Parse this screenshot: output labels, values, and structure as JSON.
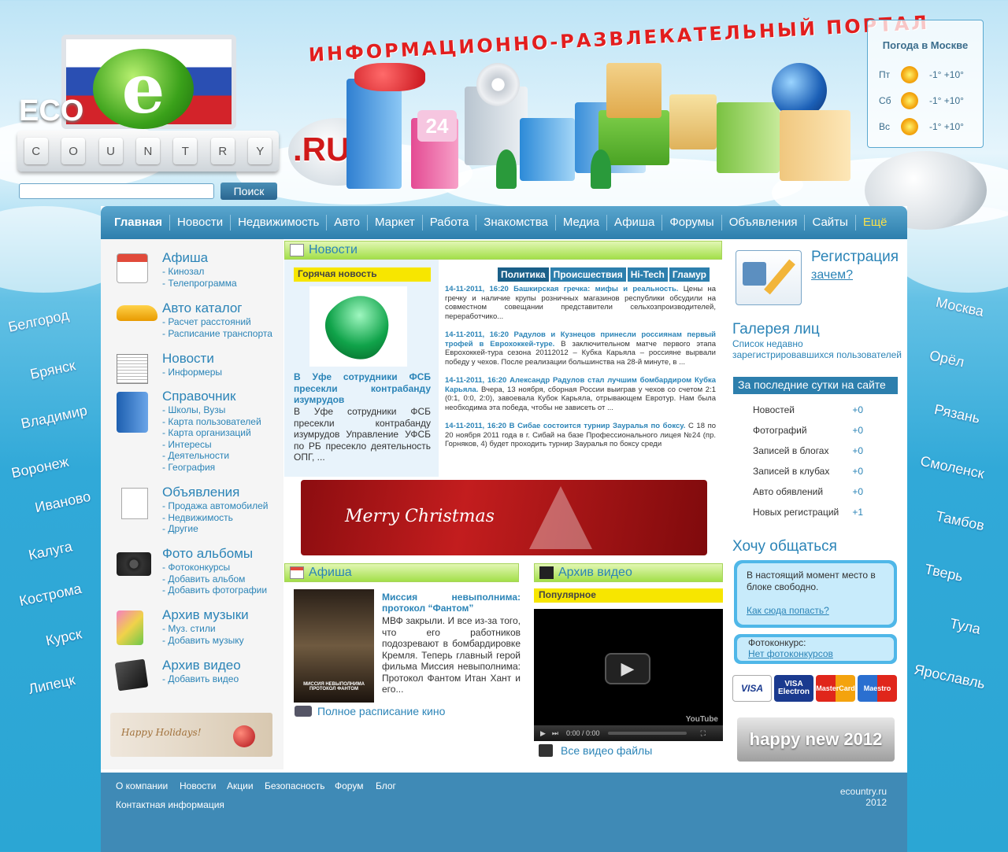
{
  "header": {
    "logo_eco": "ECO",
    "logo_letter": "e",
    "logo_keys": [
      "C",
      "O",
      "U",
      "N",
      "T",
      "R",
      "Y"
    ],
    "domain_badge": ".RU",
    "tagline": "ИНФОРМАЦИОННО-РАЗВЛЕКАТЕЛЬНЫЙ ПОРТАЛ",
    "search_placeholder": "",
    "search_button": "Поиск"
  },
  "weather": {
    "title": "Погода в Москве",
    "days": [
      {
        "day": "Пт",
        "icon": "sun-icon",
        "temp": "-1° +10°"
      },
      {
        "day": "Сб",
        "icon": "sun-icon",
        "temp": "-1° +10°"
      },
      {
        "day": "Вс",
        "icon": "sun-icon",
        "temp": "-1° +10°"
      }
    ]
  },
  "cities_left": [
    "Белгород",
    "Брянск",
    "Владимир",
    "Воронеж",
    "Иваново",
    "Калуга",
    "Кострома",
    "Курск",
    "Липецк"
  ],
  "cities_right": [
    "Москва",
    "Орёл",
    "Рязань",
    "Смоленск",
    "Тамбов",
    "Тверь",
    "Тула",
    "Ярославль"
  ],
  "nav": [
    "Главная",
    "Новости",
    "Недвижимость",
    "Авто",
    "Маркет",
    "Работа",
    "Знакомства",
    "Медиа",
    "Афиша",
    "Форумы",
    "Объявления",
    "Сайты",
    "Ещё"
  ],
  "sidebar": [
    {
      "title": "Афиша",
      "links": [
        "- Кинозал",
        "- Телепрограмма"
      ],
      "icon": "calendar-icon"
    },
    {
      "title": "Авто каталог",
      "links": [
        "- Расчет расстояний",
        "- Расписание транспорта"
      ],
      "icon": "car-icon"
    },
    {
      "title": "Новости",
      "links": [
        "- Информеры"
      ],
      "icon": "newspaper-icon"
    },
    {
      "title": "Справочник",
      "links": [
        "- Школы, Вузы",
        "- Карта пользователей",
        "- Карта организаций",
        "- Интересы",
        "- Деятельности",
        "- География"
      ],
      "icon": "address-book-icon"
    },
    {
      "title": "Объявления",
      "links": [
        "- Продажа автомобилей",
        "- Недвижимость",
        "- Другие"
      ],
      "icon": "pencil-icon"
    },
    {
      "title": "Фото альбомы",
      "links": [
        "- Фотоконкурсы",
        "- Добавить альбом",
        "- Добавить фотографии"
      ],
      "icon": "camera-icon"
    },
    {
      "title": "Архив музыки",
      "links": [
        "- Муз. стили",
        "- Добавить музыку"
      ],
      "icon": "music-icon"
    },
    {
      "title": "Архив видео",
      "links": [
        "- Добавить видео"
      ],
      "icon": "video-icon"
    }
  ],
  "holidays_banner": "Happy Holidays!",
  "news": {
    "header": "Новости",
    "hot_label": "Горячая новость",
    "hot_title": "В Уфе сотрудники ФСБ пресекли контрабанду изумрудов",
    "hot_text": "В Уфе сотрудники ФСБ пресекли контрабанду изумрудов Управление УФСБ по РБ пресекло деятельность ОПГ, ...",
    "tabs": [
      "Политика",
      "Происшествия",
      "Hi-Tech",
      "Гламур"
    ],
    "items": [
      {
        "head": "14-11-2011, 16:20 Башкирская гречка: мифы и реальность.",
        "text": "Цены на гречку и наличие крупы розничных магазинов республики обсудили на совместном совещании представители сельхозпроизводителей, переработчико..."
      },
      {
        "head": "14-11-2011, 16:20 Радулов и Кузнецов принесли россиянам первый трофей в Еврохоккей-туре.",
        "text": "В заключительном матче первого этапа Еврохоккей-тура сезона 20112012 – Кубка Карьяла – россияне вырвали победу у чехов. После реализации большинства на 28-й минуте, в ..."
      },
      {
        "head": "14-11-2011, 16:20 Александр Радулов стал лучшим бомбардиром Кубка Карьяла.",
        "text": "Вчера, 13 ноября, сборная России выиграв у чехов со счетом 2:1 (0:1, 0:0, 2:0), завоевала Кубок Карьяла, отрывающем Евротур. Нам была необходима эта победа, чтобы не зависеть от ..."
      },
      {
        "head": "14-11-2011, 16:20 В Сибае состоится турнир Зауралья по боксу.",
        "text": "С 18 по 20 ноября 2011 года в г. Сибай на базе Профессионального лицея №24 (пр. Горняков, 4) будет проходить турнир Зауралья по боксу среди"
      }
    ]
  },
  "xmas_banner": "Merry Christmas",
  "afisha": {
    "header": "Афиша",
    "poster_caption": "МИССИЯ НЕВЫПОЛНИМА ПРОТОКОЛ ФАНТОМ",
    "movie_title": "Миссия невыполнима: протокол “Фантом”",
    "movie_text": "МВФ закрыли. И все из-за того, что его работников подозревают в бомбардировке Кремля. Теперь главный герой фильма Миссия невыполнима: Протокол Фантом Итан Хант и его...",
    "schedule_link": "Полное расписание кино"
  },
  "video": {
    "header": "Архив видео",
    "popular_label": "Популярное",
    "time": "0:00 / 0:00",
    "brand": "YouTube",
    "all_link": "Все видео файлы"
  },
  "right": {
    "reg_title": "Регистрация",
    "reg_why": "зачем?",
    "faces_title": "Галерея лиц",
    "faces_sub": "Список недавно зарегистрировавшихся пользователей",
    "stats_head": "За последние сутки на сайте",
    "stats": [
      {
        "label": "Новостей",
        "value": "+0"
      },
      {
        "label": "Фотографий",
        "value": "+0"
      },
      {
        "label": "Записей в блогах",
        "value": "+0"
      },
      {
        "label": "Записей в клубах",
        "value": "+0"
      },
      {
        "label": "Авто обявлений",
        "value": "+0"
      },
      {
        "label": "Новых регистраций",
        "value": "+1"
      }
    ],
    "chat_title": "Хочу общаться",
    "chat_text": "В настоящий момент место в блоке свободно.",
    "chat_link": "Как сюда попасть?",
    "photo_label": "Фотоконкурс:",
    "photo_link": "Нет фотоконкурсов",
    "cards": [
      "VISA",
      "VISA Electron",
      "MasterCard",
      "Maestro"
    ],
    "ny_banner": "happy new 2012"
  },
  "footer": {
    "links": [
      "О компании",
      "Новости",
      "Акции",
      "Безопасность",
      "Форум",
      "Блог"
    ],
    "contact": "Контактная информация",
    "site": "ecountry.ru",
    "year": "2012"
  },
  "colors": {
    "accent": "#2b84b7",
    "nav": "#2d7fad",
    "hot": "#f7e600"
  }
}
